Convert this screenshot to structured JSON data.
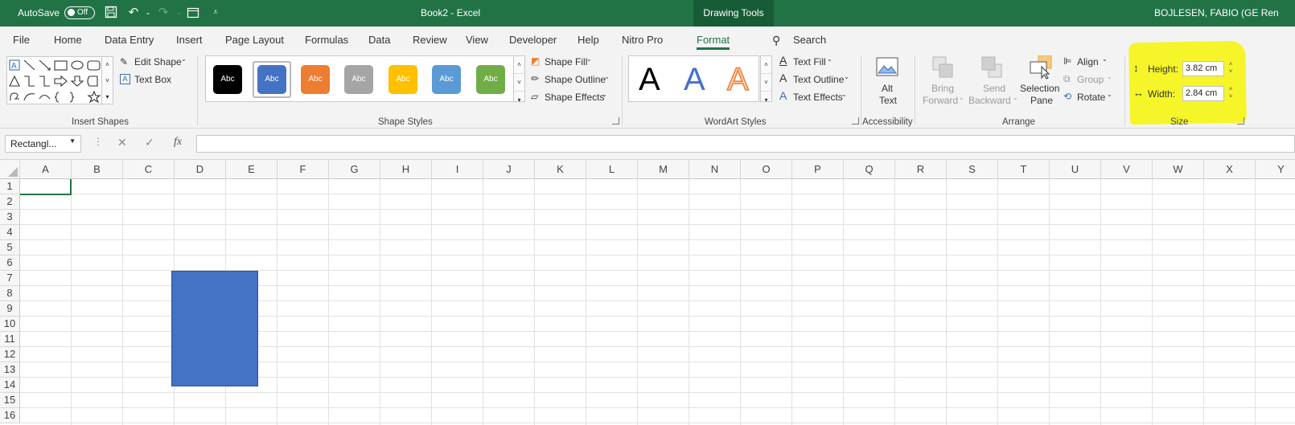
{
  "titlebar": {
    "autosave_label": "AutoSave",
    "autosave_state": "Off",
    "doc_title": "Book2  -  Excel",
    "context_tab": "Drawing Tools",
    "user": "BOJLESEN, FABIO (GE Ren"
  },
  "tabs": [
    "File",
    "Home",
    "Data Entry",
    "Insert",
    "Page Layout",
    "Formulas",
    "Data",
    "Review",
    "View",
    "Developer",
    "Help",
    "Nitro Pro",
    "Format"
  ],
  "search_label": "Search",
  "ribbon": {
    "insert_shapes": {
      "label": "Insert Shapes",
      "edit_shape": "Edit Shape",
      "text_box": "Text Box"
    },
    "shape_styles": {
      "label": "Shape Styles",
      "swatches": [
        {
          "text": "Abc",
          "color": "#000000"
        },
        {
          "text": "Abc",
          "color": "#4472c4"
        },
        {
          "text": "Abc",
          "color": "#ed7d31"
        },
        {
          "text": "Abc",
          "color": "#a5a5a5"
        },
        {
          "text": "Abc",
          "color": "#ffc000"
        },
        {
          "text": "Abc",
          "color": "#5b9bd5"
        },
        {
          "text": "Abc",
          "color": "#70ad47"
        }
      ],
      "shape_fill": "Shape Fill",
      "shape_outline": "Shape Outline",
      "shape_effects": "Shape Effects"
    },
    "wordart": {
      "label": "WordArt Styles",
      "letters": [
        "A",
        "A",
        "A"
      ],
      "text_fill": "Text Fill",
      "text_outline": "Text Outline",
      "text_effects": "Text Effects"
    },
    "accessibility": {
      "label": "Accessibility",
      "alt_text_1": "Alt",
      "alt_text_2": "Text"
    },
    "arrange": {
      "label": "Arrange",
      "bring_forward_1": "Bring",
      "bring_forward_2": "Forward",
      "send_backward_1": "Send",
      "send_backward_2": "Backward",
      "selection_pane_1": "Selection",
      "selection_pane_2": "Pane",
      "align": "Align",
      "group": "Group",
      "rotate": "Rotate"
    },
    "size": {
      "label": "Size",
      "height_label": "Height:",
      "height_value": "3.82 cm",
      "width_label": "Width:",
      "width_value": "2.84 cm"
    }
  },
  "formula_bar": {
    "name_box": "Rectangl...",
    "fx": "fx",
    "value": ""
  },
  "grid": {
    "columns": [
      "A",
      "B",
      "C",
      "D",
      "E",
      "F",
      "G",
      "H",
      "I",
      "J",
      "K",
      "L",
      "M",
      "N",
      "O",
      "P",
      "Q",
      "R",
      "S",
      "T",
      "U",
      "V",
      "W",
      "X",
      "Y"
    ],
    "rows": [
      "1",
      "2",
      "3",
      "4",
      "5",
      "6",
      "7",
      "8",
      "9",
      "10",
      "11",
      "12",
      "13",
      "14",
      "15",
      "16"
    ]
  },
  "colors": {
    "excel_green": "#217346",
    "shape_fill": "#4472c4",
    "highlight": "#f5f52a"
  }
}
